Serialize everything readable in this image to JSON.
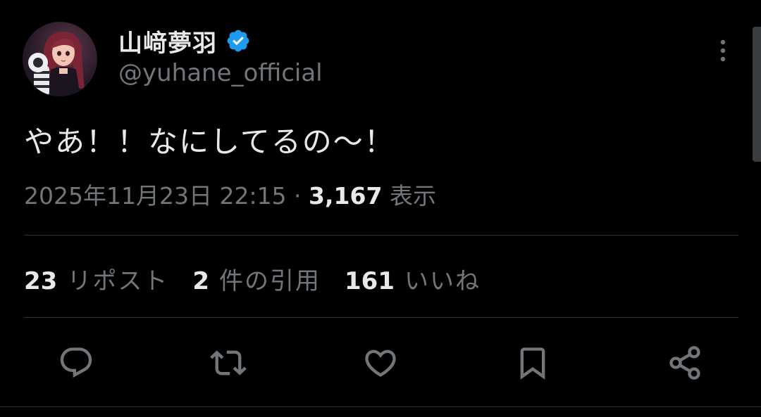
{
  "author": {
    "display_name": "山﨑夢羽",
    "handle": "@yuhane_official",
    "verified_icon": "verified-badge-icon",
    "avatar": "profile-avatar"
  },
  "tweet": {
    "text": "やあ！！なにしてるの〜！",
    "timestamp": "2025年11月23日 22:15",
    "separator": " · ",
    "views_count": "3,167",
    "views_label": "表示"
  },
  "stats": {
    "reposts_count": "23",
    "reposts_label": "リポスト",
    "quotes_count": "2",
    "quotes_label": "件の引用",
    "likes_count": "161",
    "likes_label": "いいね"
  },
  "actions": [
    {
      "icon": "reply-icon"
    },
    {
      "icon": "repost-icon"
    },
    {
      "icon": "like-icon"
    },
    {
      "icon": "bookmark-icon"
    },
    {
      "icon": "share-icon"
    }
  ],
  "colors": {
    "background": "#000000",
    "primary_text": "#e7e9ea",
    "secondary_text": "#71767b",
    "verified_blue": "#1d9bf0",
    "divider": "#2f3336"
  }
}
